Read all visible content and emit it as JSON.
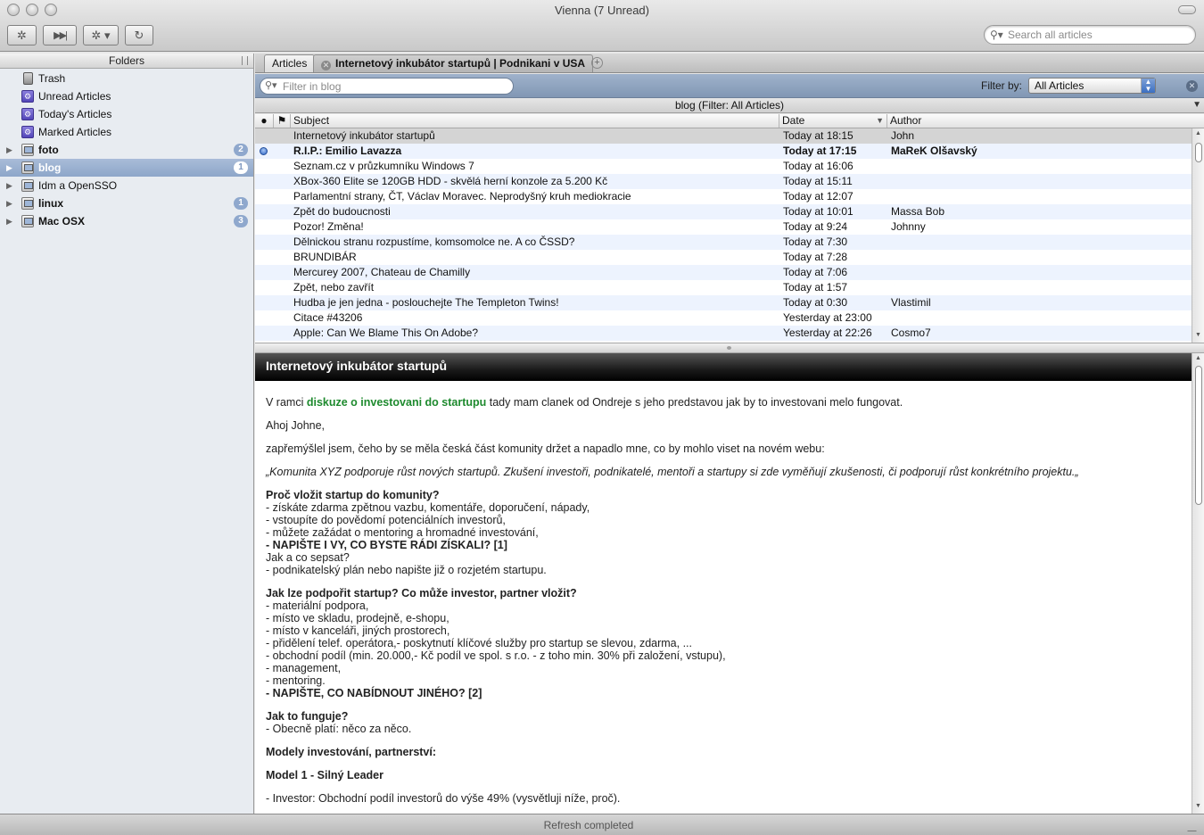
{
  "window": {
    "title": "Vienna (7 Unread)"
  },
  "toolbar": {
    "buttons": [
      "gear-icon",
      "skip-forward-icon",
      "action-menu-icon",
      "refresh-icon"
    ],
    "search_placeholder": "Search all articles"
  },
  "sidebar": {
    "header": "Folders",
    "items": [
      {
        "label": "Trash",
        "icon": "trash-icon",
        "bold": false,
        "badge": ""
      },
      {
        "label": "Unread Articles",
        "icon": "smart-folder-icon",
        "bold": false,
        "badge": ""
      },
      {
        "label": "Today's Articles",
        "icon": "smart-folder-icon",
        "bold": false,
        "badge": ""
      },
      {
        "label": "Marked Articles",
        "icon": "smart-folder-icon",
        "bold": false,
        "badge": ""
      },
      {
        "label": "foto",
        "icon": "feed-folder-icon",
        "bold": true,
        "badge": "2"
      },
      {
        "label": "blog",
        "icon": "feed-folder-icon",
        "bold": true,
        "badge": "1",
        "selected": true
      },
      {
        "label": "Idm a OpenSSO",
        "icon": "feed-folder-icon",
        "bold": false,
        "badge": ""
      },
      {
        "label": "linux",
        "icon": "feed-folder-icon",
        "bold": true,
        "badge": "1"
      },
      {
        "label": "Mac OSX",
        "icon": "feed-folder-icon",
        "bold": true,
        "badge": "3"
      }
    ]
  },
  "tabs": [
    {
      "label": "Articles",
      "active": true
    },
    {
      "label": "Internetový inkubátor startupů | Podnikani v USA",
      "active": false
    }
  ],
  "filter": {
    "placeholder": "Filter in blog",
    "label": "Filter by:",
    "selected": "All Articles"
  },
  "list": {
    "title": "blog (Filter: All Articles)",
    "columns": {
      "subject": "Subject",
      "date": "Date",
      "author": "Author"
    },
    "rows": [
      {
        "subject": "Internetový inkubátor startupů",
        "date": "Today at 18:15",
        "author": "John",
        "unread": false,
        "selected": true
      },
      {
        "subject": "R.I.P.: Emilio Lavazza",
        "date": "Today at 17:15",
        "author": "MaReK Olšavský",
        "unread": true
      },
      {
        "subject": "Seznam.cz v průzkumníku Windows 7",
        "date": "Today at 16:06",
        "author": "",
        "unread": false
      },
      {
        "subject": "XBox-360 Elite se 120GB HDD - skvělá herní konzole za 5.200 Kč",
        "date": "Today at 15:11",
        "author": "",
        "unread": false
      },
      {
        "subject": "Parlamentní strany, ČT, Václav Moravec. Neprodyšný kruh mediokracie",
        "date": "Today at 12:07",
        "author": "",
        "unread": false
      },
      {
        "subject": "Zpět do budoucnosti",
        "date": "Today at 10:01",
        "author": "Massa Bob",
        "unread": false
      },
      {
        "subject": "Pozor! Změna!",
        "date": "Today at 9:24",
        "author": "Johnny",
        "unread": false
      },
      {
        "subject": "Dělnickou stranu rozpustíme, komsomolce ne. A co ČSSD?",
        "date": "Today at 7:30",
        "author": "",
        "unread": false
      },
      {
        "subject": "BRUNDIBÁR",
        "date": "Today at 7:28",
        "author": "",
        "unread": false
      },
      {
        "subject": "Mercurey 2007, Chateau de Chamilly",
        "date": "Today at 7:06",
        "author": "",
        "unread": false
      },
      {
        "subject": "Zpět, nebo zavřít",
        "date": "Today at 1:57",
        "author": "",
        "unread": false
      },
      {
        "subject": "Hudba je jen jedna - poslouchejte The Templeton Twins!",
        "date": "Today at 0:30",
        "author": "Vlastimil",
        "unread": false
      },
      {
        "subject": "Citace #43206",
        "date": "Yesterday at 23:00",
        "author": "",
        "unread": false
      },
      {
        "subject": "Apple: Can We Blame This On Adobe?",
        "date": "Yesterday at 22:26",
        "author": "Cosmo7",
        "unread": false
      }
    ]
  },
  "article": {
    "title": "Internetový inkubátor startupů",
    "intro_before": "V ramci ",
    "intro_link": "diskuze o investovani do startupu",
    "intro_after": " tady mam clanek od Ondreje s jeho predstavou jak by to investovani melo fungovat.",
    "greeting": "Ahoj Johne,",
    "para1": "zapřemýšlel jsem, čeho by se měla česká část komunity držet a napadlo mne, co by mohlo viset na novém webu:",
    "quote": "„Komunita XYZ podporuje růst nových startupů. Zkušení investoři, podnikatelé, mentoři a startupy si zde vyměňují zkušenosti, či podporují růst konkrétního projektu.„",
    "q1": "Proč vložit startup do komunity?",
    "q1_lines": [
      "- získáte zdarma zpětnou vazbu, komentáře, doporučení, nápady,",
      "- vstoupíte do povědomí potenciálních investorů,",
      "- můžete zažádat o mentoring a hromadné investování,"
    ],
    "q1_bold": "- NAPIŠTE I VY, CO BYSTE RÁDI ZÍSKALI? [1]",
    "q1_tail": [
      "Jak a co sepsat?",
      "- podnikatelský plán nebo napište již o rozjetém startupu."
    ],
    "q2": "Jak lze podpořit startup? Co může investor, partner vložit?",
    "q2_lines": [
      "- materiální podpora,",
      "- místo ve skladu, prodejně, e-shopu,",
      "- místo v kanceláři, jiných prostorech,",
      "- přidělení telef. operátora,- poskytnutí klíčové služby pro startup se slevou, zdarma, ...",
      "- obchodní podíl (min. 20.000,- Kč podíl ve spol. s r.o. - z toho min. 30% při založení, vstupu),",
      "- management,",
      "- mentoring."
    ],
    "q2_bold": "- NAPIŠTE, CO NABÍDNOUT JINÉHO? [2]",
    "q3": "Jak to funguje?",
    "q3_line": "- Obecně platí: něco za něco.",
    "q4": "Modely investování, partnerství:",
    "q5": "Model 1 - Silný Leader",
    "last_line": "- Investor: Obchodní podíl investorů do výše 49% (vysvětluji níže, proč)."
  },
  "status": "Refresh completed"
}
